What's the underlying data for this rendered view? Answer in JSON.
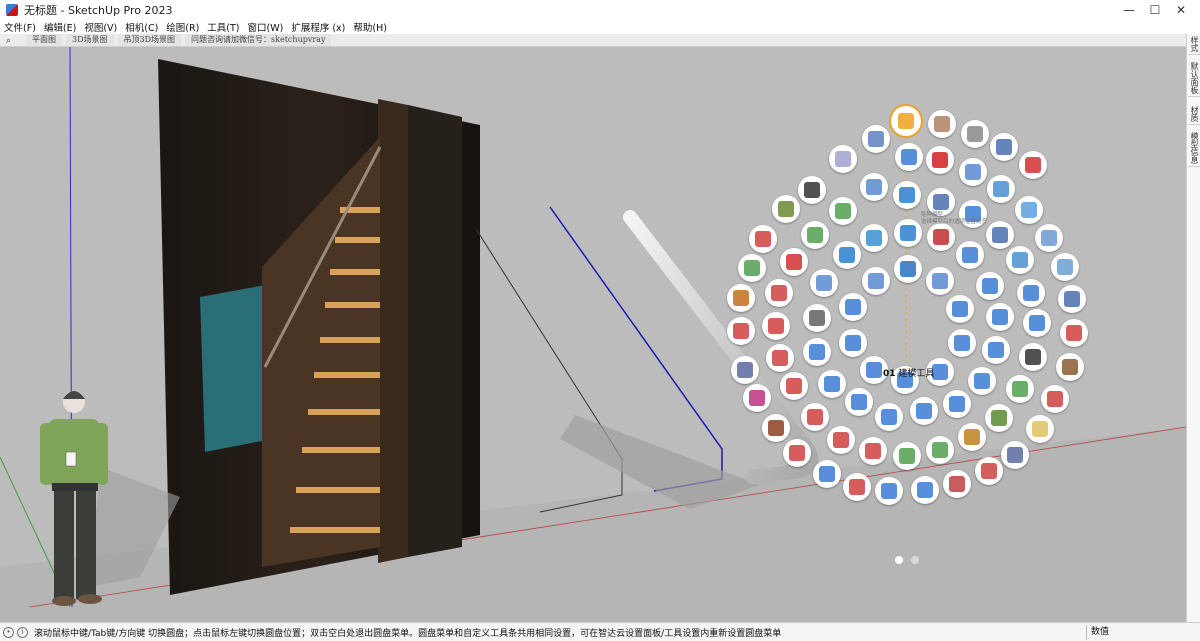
{
  "window": {
    "title": "无标题 - SketchUp Pro 2023",
    "minimize_glyph": "—",
    "maximize_glyph": "☐",
    "close_glyph": "✕"
  },
  "menu": [
    "文件(F)",
    "编辑(E)",
    "视图(V)",
    "相机(C)",
    "绘图(R)",
    "工具(T)",
    "窗口(W)",
    "扩展程序 (x)",
    "帮助(H)"
  ],
  "scene_tabs": {
    "search_icon": "search-icon",
    "tabs": [
      "平面图",
      "3D场景图",
      "吊顶3D场景图",
      "问题咨询请加微信号：sketchupvray"
    ]
  },
  "right_tabs": [
    "样式",
    "默认面板",
    "材质",
    "模型信息"
  ],
  "pie_menu": {
    "center_label_number": "01",
    "center_label_text": "建模工具",
    "tooltip_line1": "贴附模型",
    "tooltip_line2": "选择模型后的选项位置对齐",
    "pages_total": 2,
    "active_page": 1
  },
  "status": {
    "text": "滚动鼠标中键/Tab键/方向键 切换圆盘；点击鼠标左键切换圆盘位置；双击空白处退出圆盘菜单。圆盘菜单和自定义工具条共用相同设置，可在智达云设置面板/工具设置内重新设置圆盘菜单",
    "measure_label": "数值"
  },
  "colors": {
    "viewport_bg": "#bcbcbc",
    "pie_highlight": "#f0a020",
    "pie_dashed_line": "#f0a020",
    "axis_blue": "#2b2bd0",
    "axis_red": "#b84040",
    "axis_green": "#3fa03f"
  }
}
